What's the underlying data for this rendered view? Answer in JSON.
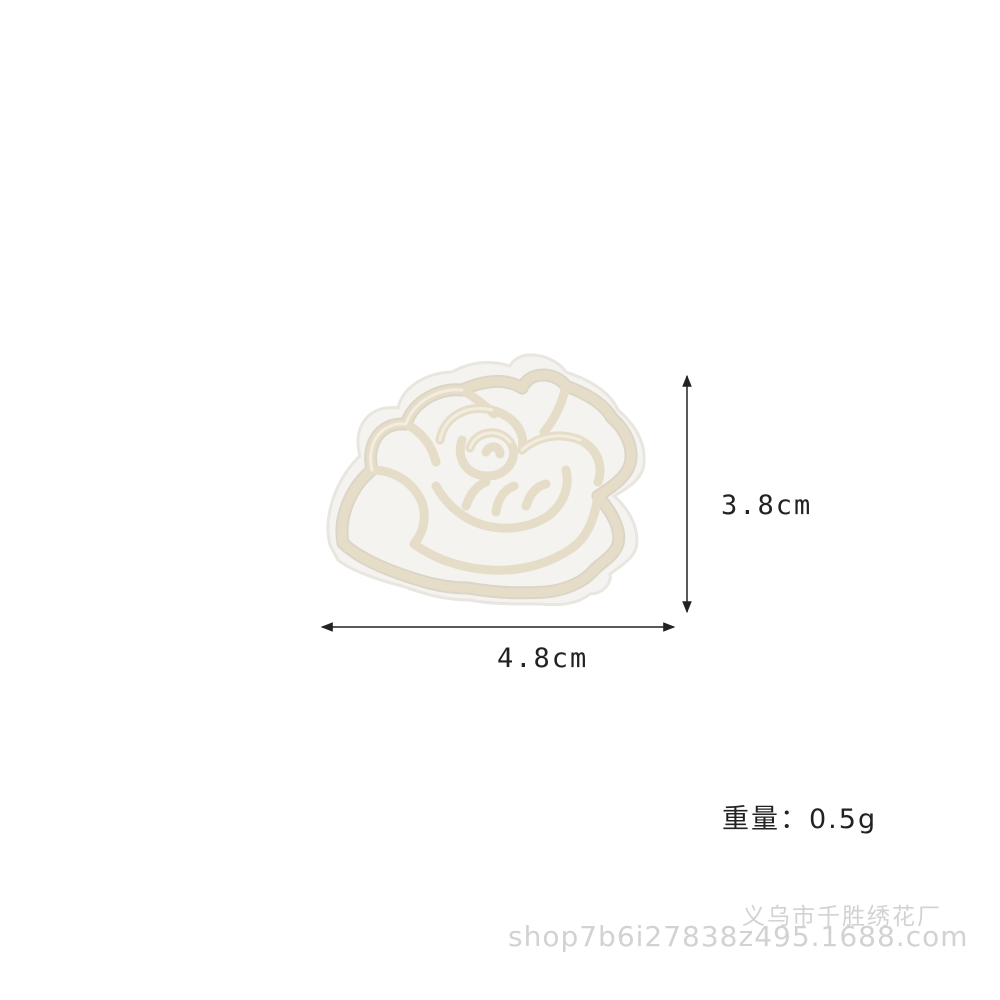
{
  "dimensions": {
    "height_label": "3.8cm",
    "width_label": "4.8cm"
  },
  "weight": {
    "label": "重量：0.5g"
  },
  "watermark": {
    "company": "义乌市千胜绣花厂",
    "url": "shop7b6i27838z495.1688.com"
  },
  "colors": {
    "background": "#ffffff",
    "patch_backing": "#f4f3ef",
    "embroidery_thread": "#e6ddc9",
    "thread_shadow": "#c9bea8",
    "dimension_line": "#222222",
    "watermark_text": "#d2d2d2"
  },
  "icons": {
    "product": "rose-embroidery-patch-icon"
  }
}
